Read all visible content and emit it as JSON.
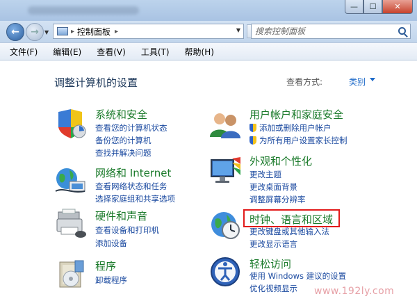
{
  "window": {
    "minimize_glyph": "—",
    "maximize_glyph": "☐",
    "close_glyph": "✕"
  },
  "address": {
    "text": "控制面板",
    "separator": "▸",
    "search_placeholder": "搜索控制面板"
  },
  "menu": [
    "文件(F)",
    "编辑(E)",
    "查看(V)",
    "工具(T)",
    "帮助(H)"
  ],
  "main": {
    "title": "调整计算机的设置",
    "view_by_label": "查看方式:",
    "view_by_value": "类别"
  },
  "categories": [
    {
      "title": "系统和安全",
      "links": [
        "查看您的计算机状态",
        "备份您的计算机",
        "查找并解决问题"
      ],
      "icon": "system-security-icon"
    },
    {
      "title": "网络和 Internet",
      "links": [
        "查看网络状态和任务",
        "选择家庭组和共享选项"
      ],
      "icon": "network-internet-icon"
    },
    {
      "title": "硬件和声音",
      "links": [
        "查看设备和打印机",
        "添加设备"
      ],
      "icon": "hardware-sound-icon"
    },
    {
      "title": "程序",
      "links": [
        "卸载程序"
      ],
      "icon": "programs-icon"
    },
    {
      "title": "用户帐户和家庭安全",
      "links": [
        "添加或删除用户帐户",
        "为所有用户设置家长控制"
      ],
      "icon": "user-accounts-icon",
      "link_shields": [
        true,
        true
      ]
    },
    {
      "title": "外观和个性化",
      "links": [
        "更改主题",
        "更改桌面背景",
        "调整屏幕分辨率"
      ],
      "icon": "appearance-icon"
    },
    {
      "title": "时钟、语言和区域",
      "links": [
        "更改键盘或其他输入法",
        "更改显示语言"
      ],
      "icon": "clock-language-region-icon"
    },
    {
      "title": "轻松访问",
      "links": [
        "使用 Windows 建议的设置",
        "优化视频显示"
      ],
      "icon": "ease-of-access-icon"
    }
  ],
  "watermark": "www.192ly.com",
  "colors": {
    "category_title": "#1a7a2a",
    "link": "#1b4aa0",
    "highlight": "#e21a1a",
    "header_text": "#1e395b"
  }
}
